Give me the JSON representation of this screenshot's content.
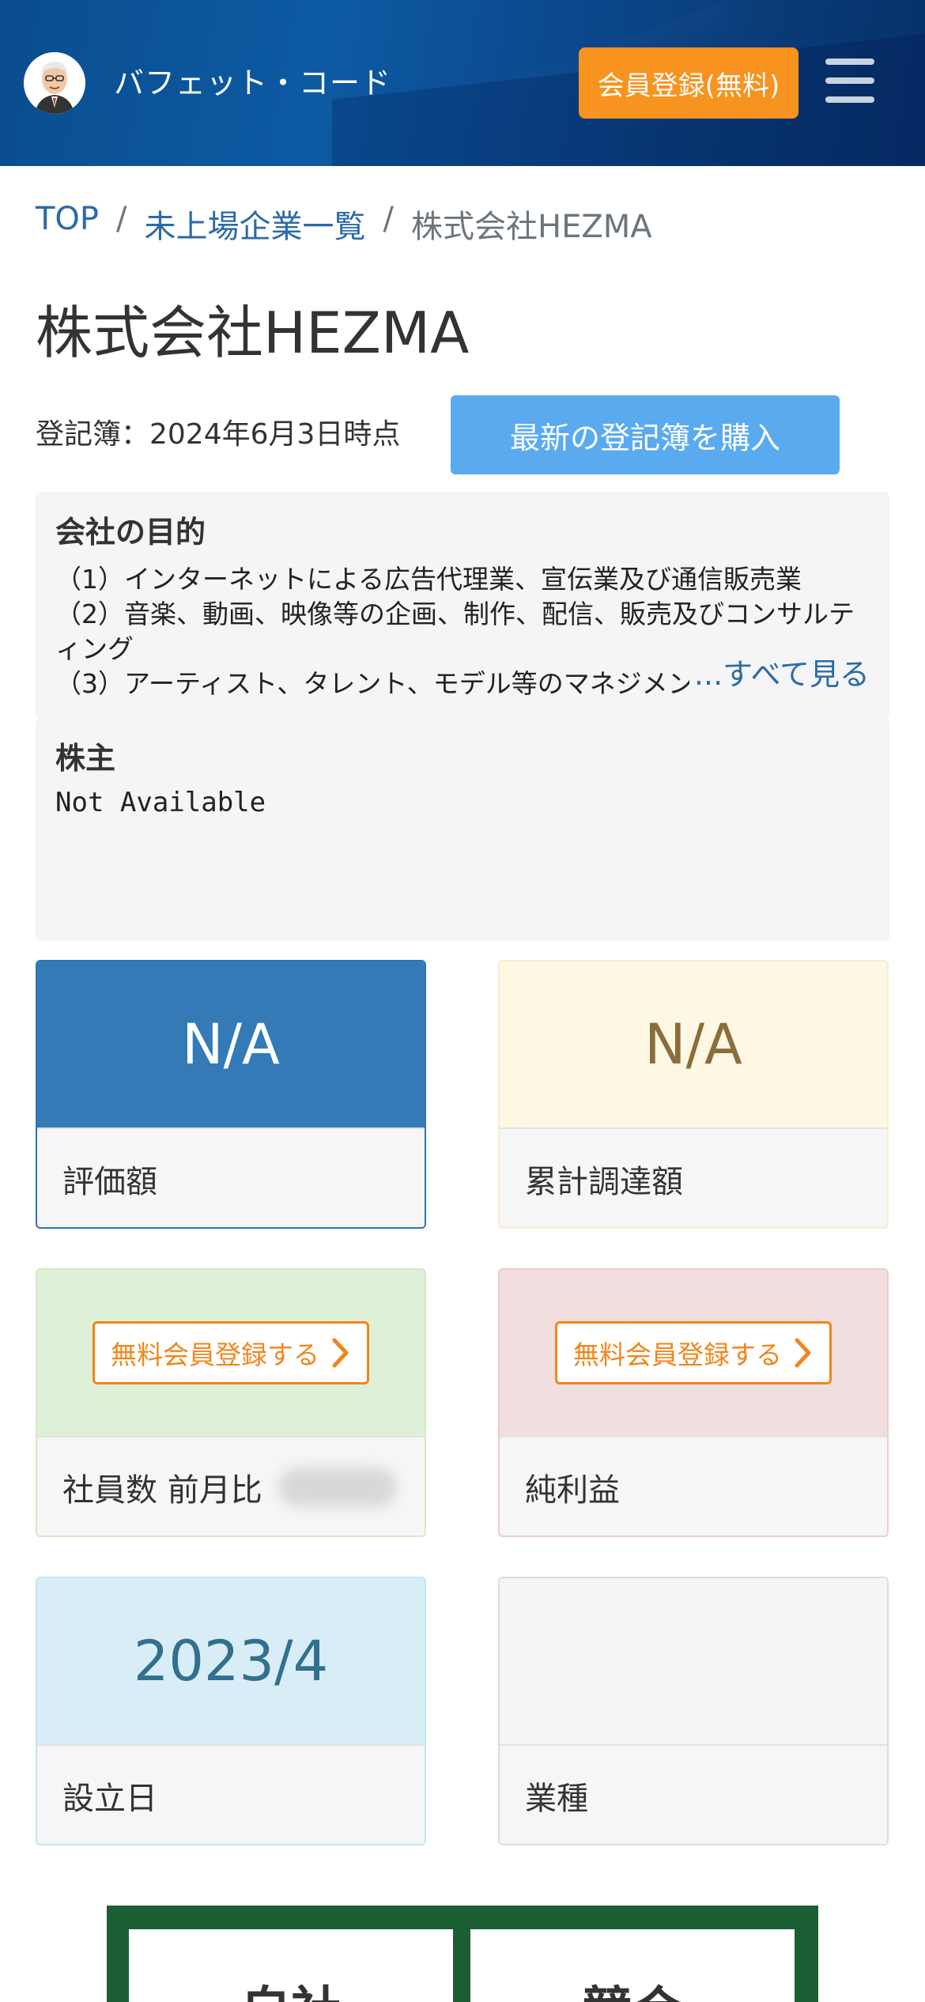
{
  "header": {
    "site_name": "バフェット・コード",
    "register_label": "会員登録(無料)"
  },
  "breadcrumb": {
    "items": [
      "TOP",
      "未上場企業一覧",
      "株式会社HEZMA"
    ],
    "separator": "/"
  },
  "page": {
    "title": "株式会社HEZMA",
    "registry_text": "登記簿：2024年6月3日時点",
    "buy_label": "最新の登記簿を購入"
  },
  "purpose": {
    "title": "会社の目的",
    "text": "（1）インターネットによる広告代理業、宣伝業及び通信販売業\n（2）音楽、動画、映像等の企画、制作、配信、販売及びコンサルティング\n（3）アーティスト、タレント、モデル等のマネジメント",
    "see_all": "すべて見る",
    "ellipsis": "..."
  },
  "shareholders": {
    "title": "株主",
    "value": "Not Available"
  },
  "cards": {
    "valuation": {
      "value": "N/A",
      "label": "評価額"
    },
    "funding": {
      "value": "N/A",
      "label": "累計調達額"
    },
    "employees": {
      "button": "無料会員登録する",
      "label": "社員数 前月比"
    },
    "net_income": {
      "button": "無料会員登録する",
      "label": "純利益"
    },
    "founded": {
      "value": "2023/4",
      "label": "設立日"
    },
    "industry": {
      "value": "",
      "label": "業種"
    }
  },
  "banner": {
    "left": "自社",
    "right": "競合"
  }
}
